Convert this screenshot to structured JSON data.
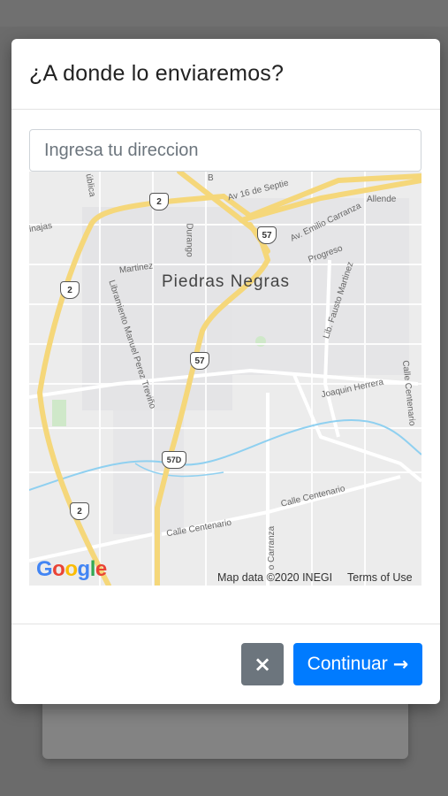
{
  "modal": {
    "title": "¿A donde lo enviaremos?",
    "address_placeholder": "Ingresa tu direccion",
    "address_value": ""
  },
  "map": {
    "city": "Piedras Negras",
    "streets": {
      "av_16": "Av 16 de Septie",
      "allende": "Allende",
      "emilio_carranza": "Av. Emilio Carranza",
      "progreso": "Progreso",
      "durango": "Durango",
      "martinez": "Martinez",
      "libramiento": "Libramiento Manuel Perez Treviño",
      "fausto_martinez": "Lib. Fausto Martinez",
      "calle_centenario_right": "Calle Centenario",
      "joaquin_herrera": "Joaquin Herrera",
      "calle_centenario_lower": "Calle Centenario",
      "calle_centenario_left": "Calle Centenario",
      "carranza": "o Carranza",
      "ublica": "ública",
      "inajas": "inajas",
      "b": "B"
    },
    "shields": {
      "s2_top": "2",
      "s57_top": "57",
      "s2_left": "2",
      "s57_mid": "57",
      "s57d": "57D",
      "s2_bottom": "2"
    },
    "logo": {
      "g1": "G",
      "o1": "o",
      "o2": "o",
      "g2": "g",
      "l": "l",
      "e": "e"
    },
    "attribution": "Map data ©2020 INEGI",
    "terms": "Terms of Use"
  },
  "footer": {
    "close_icon": "×",
    "continue_label": "Continuar",
    "continue_icon": "→"
  }
}
